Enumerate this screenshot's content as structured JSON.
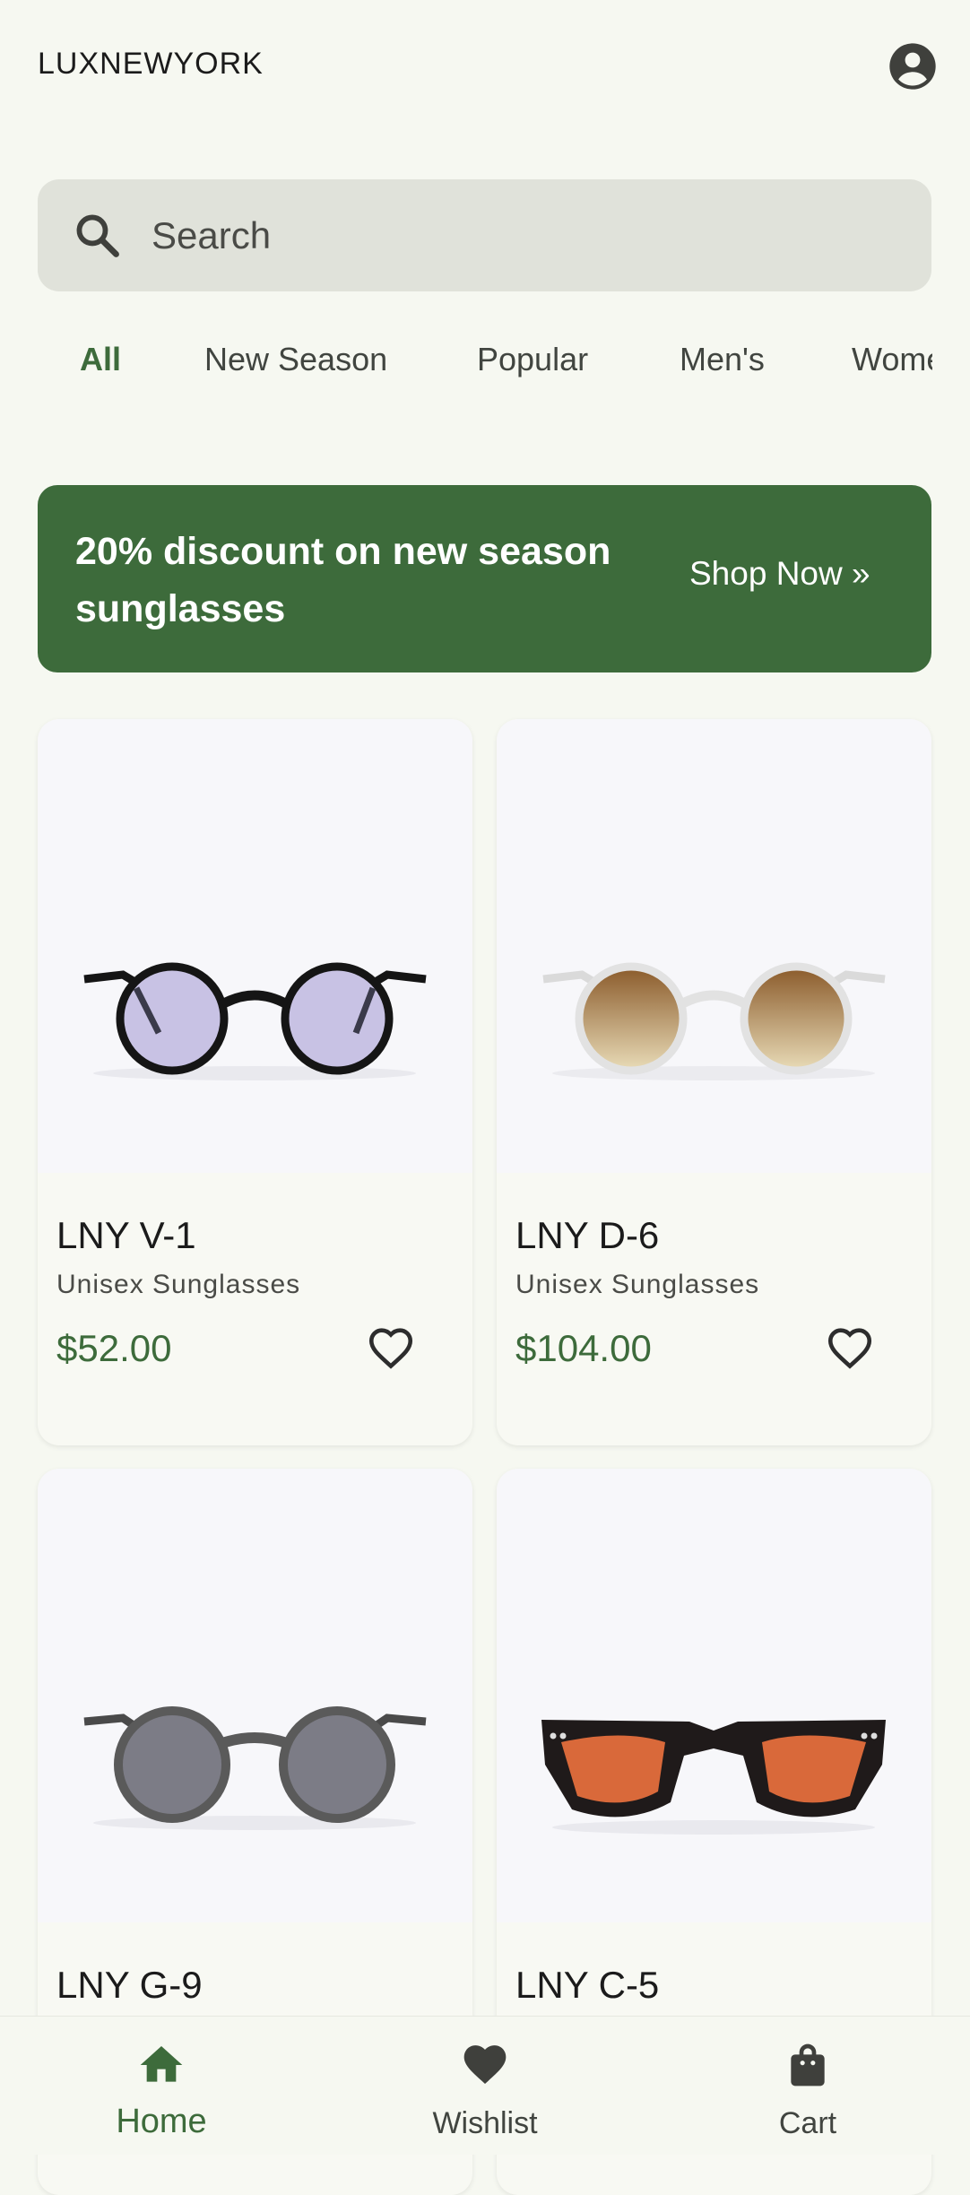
{
  "app": {
    "brand": "LUXNEWYORK"
  },
  "search": {
    "placeholder": "Search"
  },
  "tabs": [
    {
      "label": "All",
      "active": true
    },
    {
      "label": "New Season",
      "active": false
    },
    {
      "label": "Popular",
      "active": false
    },
    {
      "label": "Men's",
      "active": false
    },
    {
      "label": "Women's",
      "active": false
    }
  ],
  "banner": {
    "message": "20% discount on new season sunglasses",
    "cta": "Shop Now »"
  },
  "products": [
    {
      "name": "LNY V-1",
      "subtitle": "Unisex Sunglasses",
      "price": "$52.00"
    },
    {
      "name": "LNY D-6",
      "subtitle": "Unisex Sunglasses",
      "price": "$104.00"
    },
    {
      "name": "LNY G-9",
      "subtitle": "",
      "price": ""
    },
    {
      "name": "LNY C-5",
      "subtitle": "",
      "price": ""
    }
  ],
  "nav": {
    "home": "Home",
    "wishlist": "Wishlist",
    "cart": "Cart"
  },
  "colors": {
    "accent": "#3d6b3b",
    "background": "#f6f8f1",
    "search_bg": "#e0e2da"
  },
  "icons": [
    "account-icon",
    "search-icon",
    "heart-outline-icon",
    "home-icon",
    "heart-icon",
    "shopping-bag-icon"
  ]
}
